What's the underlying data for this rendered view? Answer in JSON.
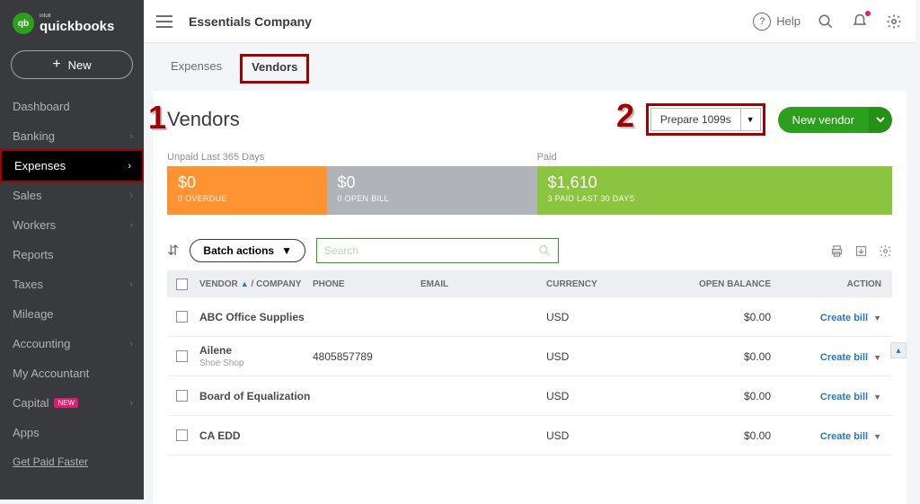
{
  "brand": {
    "intuit": "intuit",
    "name": "quickbooks"
  },
  "new_button": "New",
  "sidebar": [
    {
      "label": "Dashboard",
      "chevron": false
    },
    {
      "label": "Banking",
      "chevron": true
    },
    {
      "label": "Expenses",
      "chevron": true,
      "active": true
    },
    {
      "label": "Sales",
      "chevron": true
    },
    {
      "label": "Workers",
      "chevron": true
    },
    {
      "label": "Reports",
      "chevron": false
    },
    {
      "label": "Taxes",
      "chevron": true
    },
    {
      "label": "Mileage",
      "chevron": false
    },
    {
      "label": "Accounting",
      "chevron": true
    },
    {
      "label": "My Accountant",
      "chevron": false
    },
    {
      "label": "Capital",
      "chevron": true,
      "badge": "NEW"
    },
    {
      "label": "Apps",
      "chevron": false
    }
  ],
  "sidebar_footer": "Get Paid Faster",
  "header": {
    "company": "Essentials Company",
    "help": "Help"
  },
  "tabs": {
    "expenses": "Expenses",
    "vendors": "Vendors"
  },
  "page_title": "Vendors",
  "prepare_btn": "Prepare 1099s",
  "new_vendor_btn": "New vendor",
  "annotations": {
    "one": "1",
    "two": "2"
  },
  "status": {
    "unpaid_label": "Unpaid Last 365 Days",
    "paid_label": "Paid",
    "overdue_amount": "$0",
    "overdue_sub": "0 OVERDUE",
    "open_amount": "$0",
    "open_sub": "0 OPEN BILL",
    "paid_amount": "$1,610",
    "paid_sub": "3 PAID LAST 30 DAYS"
  },
  "toolbar": {
    "batch": "Batch actions",
    "search_placeholder": "Search"
  },
  "columns": {
    "vendor": "VENDOR",
    "company": "COMPANY",
    "phone": "PHONE",
    "email": "EMAIL",
    "currency": "CURRENCY",
    "balance": "OPEN BALANCE",
    "action": "ACTION"
  },
  "action_label": "Create bill",
  "rows": [
    {
      "name": "ABC Office Supplies",
      "sub": "",
      "phone": "",
      "currency": "USD",
      "balance": "$0.00"
    },
    {
      "name": "Ailene",
      "sub": "Shoe Shop",
      "phone": "4805857789",
      "currency": "USD",
      "balance": "$0.00"
    },
    {
      "name": "Board of Equalization",
      "sub": "",
      "phone": "",
      "currency": "USD",
      "balance": "$0.00"
    },
    {
      "name": "CA EDD",
      "sub": "",
      "phone": "",
      "currency": "USD",
      "balance": "$0.00"
    }
  ]
}
